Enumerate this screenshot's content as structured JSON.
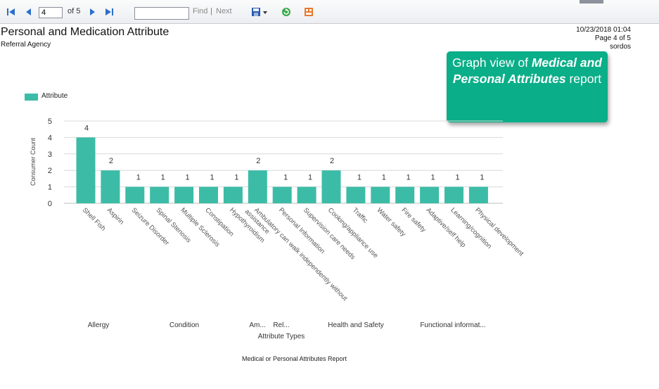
{
  "toolbar": {
    "page_current": "4",
    "page_of": "of 5",
    "find_label": "Find",
    "separator": "|",
    "next_label": "Next"
  },
  "report": {
    "title": "Personal and Medication Attribute",
    "subtitle": "Referral Agency",
    "date": "10/23/2018 01:04",
    "page_info": "Page 4 of 5",
    "user": "sordos"
  },
  "callout": {
    "prefix": "Graph view of ",
    "emphasis": "Medical and Personal Attributes",
    "suffix": " report"
  },
  "footer": "Medical or Personal Attributes Report",
  "colors": {
    "bar": "#3cbca7",
    "callout": "#0aae88",
    "toolbar_icon": "#2a6fc9"
  },
  "chart_data": {
    "type": "bar",
    "ylabel": "Consumer Count",
    "xlabel": "Attribute Types",
    "ylim": [
      0,
      5
    ],
    "yticks": [
      0,
      1,
      2,
      3,
      4,
      5
    ],
    "grid": true,
    "legend": "top-left",
    "series": [
      {
        "name": "Attribute",
        "values": [
          4,
          2,
          1,
          1,
          1,
          1,
          1,
          2,
          1,
          1,
          2,
          1,
          1,
          1,
          1,
          1,
          1
        ]
      }
    ],
    "categories": [
      "Shell Fish",
      "Aspirin",
      "Seizure Disorder",
      "Spinal Stenosis",
      "Multiple Sclerosis",
      "Constipation",
      "Hypothyroidism",
      "Ambulatory can walk independently without assistance",
      "Personal Information",
      "Supervision care needs",
      "Cooking/appliance use",
      "Traffic",
      "Water safety",
      "Fire safety",
      "Adaptive/self help",
      "Learning/cognition",
      "Physical development"
    ],
    "category_lines": [
      [
        "Shell Fish"
      ],
      [
        "Aspirin"
      ],
      [
        "Seizure Disorder"
      ],
      [
        "Spinal Stenosis"
      ],
      [
        "Multiple Sclerosis"
      ],
      [
        "Constipation"
      ],
      [
        "Hypothyroidism"
      ],
      [
        "Ambulatory can walk independently without",
        "assistance"
      ],
      [
        "Personal Information"
      ],
      [
        "Supervision care needs"
      ],
      [
        "Cooking/appliance use"
      ],
      [
        "Traffic"
      ],
      [
        "Water safety"
      ],
      [
        "Fire safety"
      ],
      [
        "Adaptive/self help"
      ],
      [
        "Learning/cognition"
      ],
      [
        "Physical development"
      ]
    ],
    "groups": [
      {
        "label": "Allergy",
        "start": 0,
        "end": 1
      },
      {
        "label": "Condition",
        "start": 2,
        "end": 6
      },
      {
        "label": "Am...",
        "start": 7,
        "end": 7
      },
      {
        "label": "Rel...",
        "start": 8,
        "end": 8
      },
      {
        "label": "Health and Safety",
        "start": 9,
        "end": 13
      },
      {
        "label": "Functional informat...",
        "start": 14,
        "end": 16
      }
    ]
  }
}
